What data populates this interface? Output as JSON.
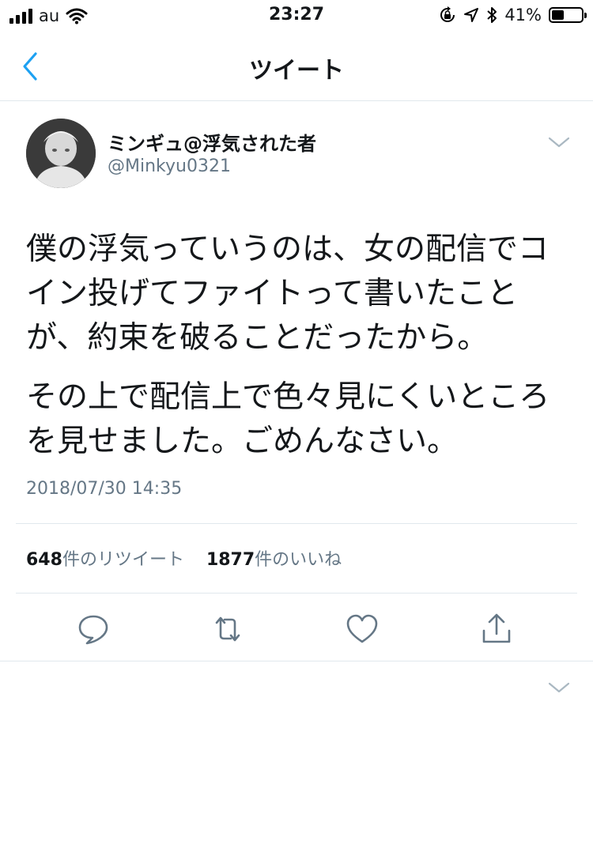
{
  "status_bar": {
    "carrier": "au",
    "time": "23:27",
    "battery_percent": "41%",
    "battery_level": 0.41,
    "icons": [
      "signal-bars-icon",
      "wifi-icon",
      "rotation-lock-icon",
      "location-arrow-icon",
      "bluetooth-icon",
      "battery-icon"
    ]
  },
  "nav": {
    "title": "ツイート",
    "back_icon": "chevron-left-icon"
  },
  "tweet": {
    "display_name": "ミンギュ@浮気された者",
    "handle": "@Minkyu0321",
    "paragraphs": [
      "僕の浮気っていうのは、女の配信でコイン投げてファイトって書いたことが、約束を破ることだったから。",
      "その上で配信上で色々見にくいところを見せました。ごめんなさい。"
    ],
    "timestamp": "2018/07/30 14:35"
  },
  "stats": {
    "retweet_count": "648",
    "retweet_label": "件のリツイート",
    "like_count": "1877",
    "like_label": "件のいいね"
  },
  "actions": [
    "reply-icon",
    "retweet-icon",
    "like-icon",
    "share-icon"
  ],
  "colors": {
    "accent": "#1da1f2",
    "secondary_text": "#657786",
    "divider": "#e1e8ed"
  }
}
